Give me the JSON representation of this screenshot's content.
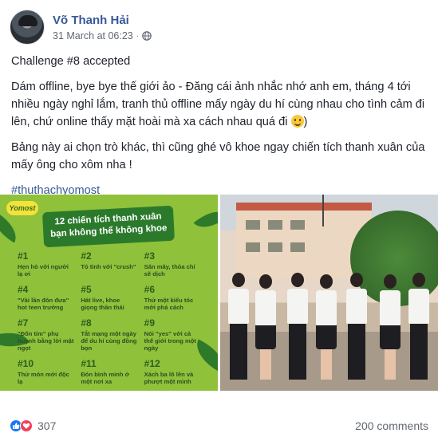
{
  "post": {
    "author": "Võ Thanh Hải",
    "timestamp": "31 March at 06:23",
    "separator": "·",
    "privacy_icon": "globe-icon",
    "paragraphs": [
      "Challenge #8 accepted",
      "Dám offline, bye bye thế giới ảo - Đăng cái ảnh nhắc nhớ anh em, tháng 4 tới nhiều ngày nghỉ lắm, tranh thủ offline mấy ngày du hí cùng nhau cho tình cảm đi lên, chứ online thấy mặt hoài mà xa cách nhau quá đi",
      "Bảng này ai chọn trò khác, thì cũng ghé vô khoe ngay chiến tích thanh xuân của mấy ông cho xôm nha !"
    ],
    "paragraph2_suffix": ")",
    "hashtag": "#thuthachyomost"
  },
  "infographic": {
    "brand": "Yomost",
    "title_line1": "12 chiến tích thanh xuân",
    "title_line2": "bạn không thể không khoe",
    "items": [
      {
        "num": "#1",
        "text": "Hẹn hò với người lạ ơi"
      },
      {
        "num": "#2",
        "text": "Tỏ tình với \"crush\""
      },
      {
        "num": "#3",
        "text": "Săn mây, thỏa chí sẽ dịch"
      },
      {
        "num": "#4",
        "text": "\"Vài lần đón đưa\" hot teen trường"
      },
      {
        "num": "#5",
        "text": "Hát live, khoe giọng thần thái"
      },
      {
        "num": "#6",
        "text": "Thử một kiểu tóc mới phá cách"
      },
      {
        "num": "#7",
        "text": "\"Đốn tim\" phụ huynh bằng lời mật ngọt"
      },
      {
        "num": "#8",
        "text": "Tắt mạng một ngày để du hí cùng đồng bọn"
      },
      {
        "num": "#9",
        "text": "Nói \"yes\" với cả thế giới trong một ngày"
      },
      {
        "num": "#10",
        "text": "Thử món mới độc lạ"
      },
      {
        "num": "#11",
        "text": "Đón bình minh ở một nơi xa"
      },
      {
        "num": "#12",
        "text": "Xách ba lô lên và phượt một mình"
      }
    ]
  },
  "footer": {
    "reaction_icons": [
      "like-icon",
      "love-icon"
    ],
    "reaction_count": "307",
    "comments": "200 comments"
  },
  "colors": {
    "link": "#385898",
    "infographic_bg": "#8fc13a",
    "like": "#1877f2",
    "love": "#f33e58"
  }
}
